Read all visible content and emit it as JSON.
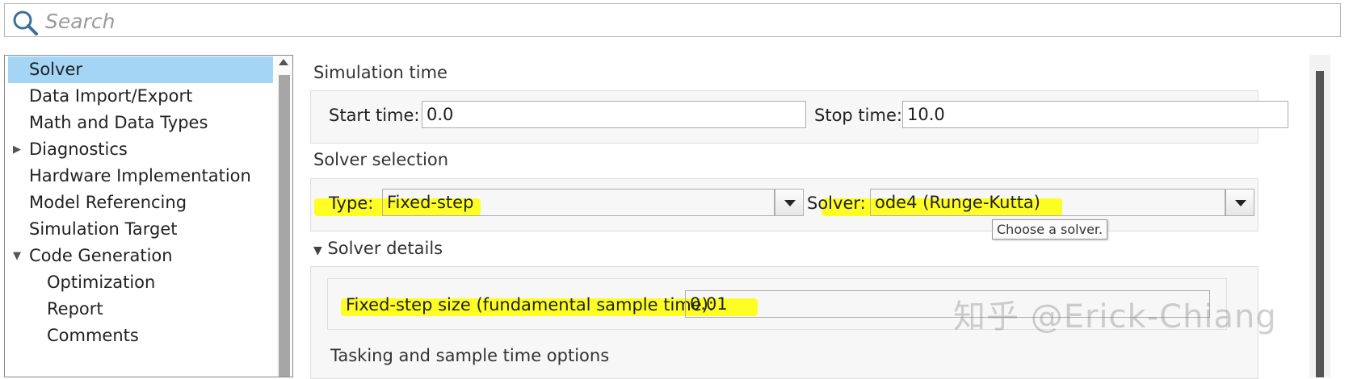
{
  "search": {
    "placeholder": "Search",
    "value": ""
  },
  "tree": {
    "items": [
      {
        "label": "Solver",
        "selected": true,
        "indent": 0
      },
      {
        "label": "Data Import/Export",
        "indent": 0
      },
      {
        "label": "Math and Data Types",
        "indent": 0
      },
      {
        "label": "Diagnostics",
        "indent": 0,
        "expander": "collapsed"
      },
      {
        "label": "Hardware Implementation",
        "indent": 0
      },
      {
        "label": "Model Referencing",
        "indent": 0
      },
      {
        "label": "Simulation Target",
        "indent": 0
      },
      {
        "label": "Code Generation",
        "indent": 0,
        "expander": "expanded"
      },
      {
        "label": "Optimization",
        "indent": 1
      },
      {
        "label": "Report",
        "indent": 1
      },
      {
        "label": "Comments",
        "indent": 1
      }
    ]
  },
  "simulation_time": {
    "title": "Simulation time",
    "start_label": "Start time:",
    "start_value": "0.0",
    "stop_label": "Stop time:",
    "stop_value": "10.0"
  },
  "solver_selection": {
    "title": "Solver selection",
    "type_label": "Type:",
    "type_value": "Fixed-step",
    "solver_label": "Solver:",
    "solver_value": "ode4 (Runge-Kutta)",
    "tooltip": "Choose a solver."
  },
  "solver_details": {
    "title": "Solver details",
    "fixed_step_label": "Fixed-step size (fundamental sample time):",
    "fixed_step_value": "0.01",
    "next_section_partial": "Tasking and sample time options"
  },
  "watermark": "知乎 @Erick-Chiang",
  "colors": {
    "selection": "#a5d5f5",
    "highlight": "#ffff00"
  }
}
